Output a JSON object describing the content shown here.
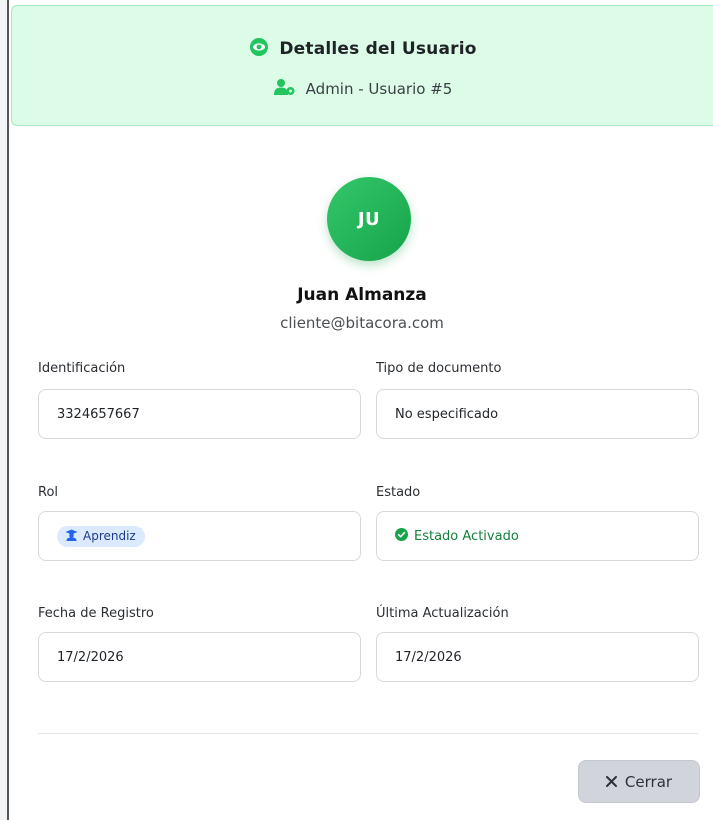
{
  "header": {
    "title": "Detalles del Usuario",
    "subtitle": "Admin - Usuario #5",
    "title_icon": "eye-icon",
    "subtitle_icon": "user-gear-icon",
    "accent": "#22c55e"
  },
  "profile": {
    "initials": "JU",
    "name": "Juan Almanza",
    "email": "cliente@bitacora.com"
  },
  "fields": {
    "identificacion": {
      "label": "Identificación",
      "value": "3324657667"
    },
    "tipo_documento": {
      "label": "Tipo de documento",
      "value": "No especificado"
    },
    "rol": {
      "label": "Rol",
      "value": "Aprendiz",
      "icon": "graduate-icon",
      "badge_color": "#dbeafe"
    },
    "estado": {
      "label": "Estado",
      "value": "Estado Activado",
      "icon": "check-circle-icon",
      "color": "#16a34a"
    },
    "fecha_registro": {
      "label": "Fecha de Registro",
      "value": "17/2/2026"
    },
    "ultima_actualizacion": {
      "label": "Última Actualización",
      "value": "17/2/2026"
    }
  },
  "footer": {
    "close_label": "Cerrar",
    "close_icon": "close-icon"
  }
}
